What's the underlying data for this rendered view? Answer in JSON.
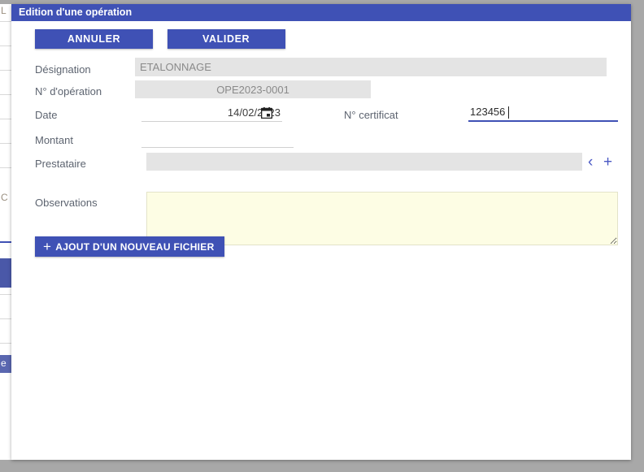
{
  "dialog": {
    "title": "Edition d'une opération"
  },
  "actions": {
    "cancel_label": "ANNULER",
    "validate_label": "VALIDER"
  },
  "form": {
    "designation": {
      "label": "Désignation",
      "value": "ETALONNAGE",
      "state": "disabled"
    },
    "operation_number": {
      "label": "N° d'opération",
      "value": "OPE2023-0001",
      "state": "disabled"
    },
    "date": {
      "label": "Date",
      "value": "14/02/2023",
      "icon": "calendar-icon"
    },
    "certificate_number": {
      "label": "N° certificat",
      "value": "123456",
      "state": "focused"
    },
    "amount": {
      "label": "Montant",
      "value": "",
      "placeholder": ""
    },
    "provider": {
      "label": "Prestataire",
      "value": "",
      "state": "disabled",
      "prev_icon": "chevron-left-icon",
      "add_icon": "plus-icon"
    },
    "observations": {
      "label": "Observations",
      "value": "",
      "placeholder": ""
    }
  },
  "file_upload": {
    "label": "AJOUT D'UN NOUVEAU FICHIER",
    "icon": "plus-icon"
  },
  "background_page": {
    "fragments": [
      "L",
      "C",
      "e"
    ]
  },
  "colors": {
    "primary": "#3f51b5",
    "titlebar": "#3f51b5",
    "disabled_field": "#e4e4e4",
    "textarea": "#fdfde4",
    "label_text": "#5d6470",
    "icon_blue": "#4a58c4",
    "page_backdrop": "#a8a8a8"
  }
}
